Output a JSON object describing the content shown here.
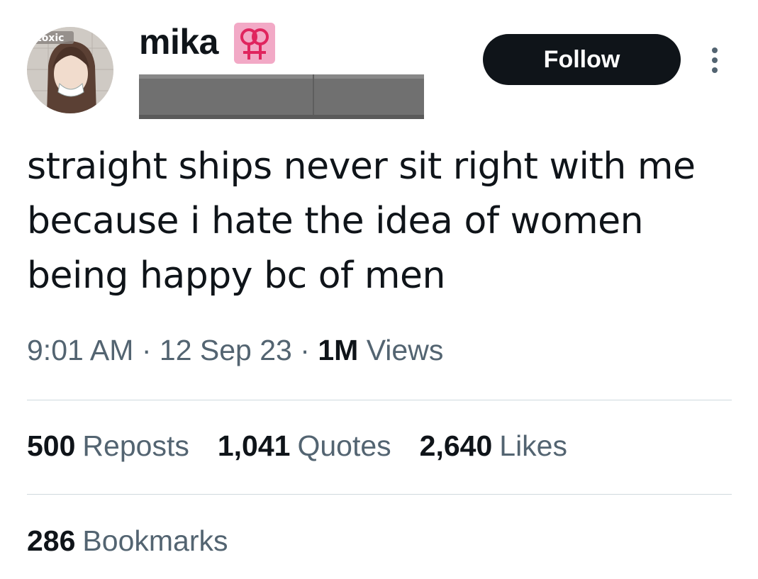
{
  "author": {
    "display_name": "mika",
    "avatar_text": "toxic",
    "badge_emoji": "⚢"
  },
  "actions": {
    "follow_label": "Follow"
  },
  "tweet": {
    "lines": [
      "straight ships never sit right with me",
      "because i hate the idea of women",
      "being happy bc of men"
    ],
    "time": "9:01 AM",
    "date": "12 Sep 23",
    "separator": "·",
    "views_count": "1M",
    "views_label": "Views"
  },
  "stats": {
    "reposts_count": "500",
    "reposts_label": "Reposts",
    "quotes_count": "1,041",
    "quotes_label": "Quotes",
    "likes_count": "2,640",
    "likes_label": "Likes",
    "bookmarks_count": "286",
    "bookmarks_label": "Bookmarks"
  },
  "colors": {
    "text_primary": "#0f1419",
    "text_secondary": "#536471",
    "divider": "#cfd9de",
    "badge_bg": "#f2a9c6",
    "badge_symbol": "#e0245e"
  }
}
